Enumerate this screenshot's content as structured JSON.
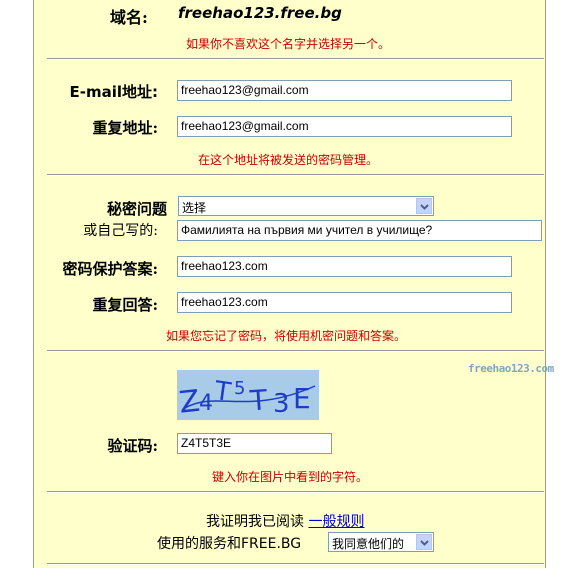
{
  "domain_section": {
    "label": "域名:",
    "value": "freehao123.free.bg",
    "hint": "如果你不喜欢这个名字并选择另一个。"
  },
  "email_section": {
    "email_label": "E-mail地址:",
    "email_value": "freehao123@gmail.com",
    "repeat_label": "重复地址:",
    "repeat_value": "freehao123@gmail.com",
    "hint": "在这个地址将被发送的密码管理。"
  },
  "security_section": {
    "question_label": "秘密问题",
    "question_select": "选择",
    "custom_label": "或自己写的:",
    "custom_value": "Фамилията на първия ми учител в училище?",
    "answer_label": "密码保护答案:",
    "answer_value": "freehao123.com",
    "repeat_answer_label": "重复回答:",
    "repeat_answer_value": "freehao123.com",
    "hint": "如果您忘记了密码，将使用机密问题和答案。"
  },
  "captcha_section": {
    "watermark": "freehao123.com",
    "captcha_text": "Z4T5T3E",
    "label": "验证码:",
    "value": "Z4T5T3E",
    "hint": "键入你在图片中看到的字符。"
  },
  "terms_section": {
    "line1_prefix": "我证明我已阅读",
    "rules_link": "一般规则",
    "line2_prefix": "使用的服务和FREE.BG",
    "agree_select": "我同意他们的"
  },
  "colors": {
    "panel_bg": "#ffffcc",
    "hint_red": "#cc0000",
    "link_blue": "#0000cc",
    "captcha_bg": "#a8cce8",
    "captcha_ink": "#1e3cc8"
  }
}
